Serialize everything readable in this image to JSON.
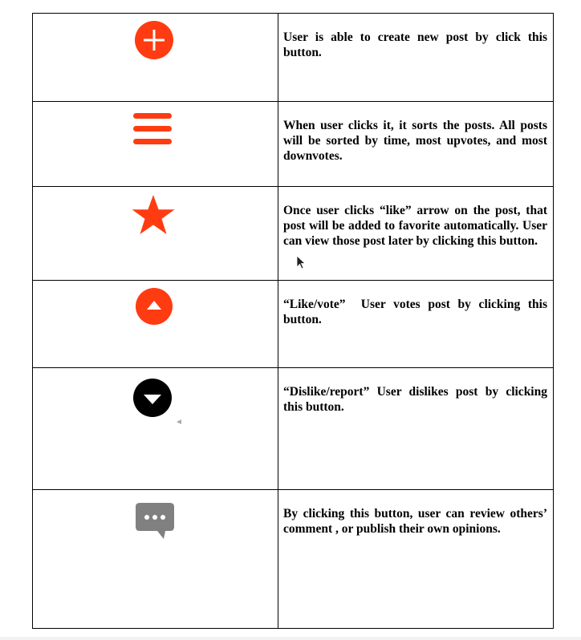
{
  "colors": {
    "accent": "#ff3b12",
    "dislike_icon": "#000000",
    "comment_icon": "#808080",
    "border": "#000000"
  },
  "rows": [
    {
      "icon": "plus-circle-icon",
      "description": "User is able to create new post by click this button."
    },
    {
      "icon": "menu-icon",
      "description": "When user clicks it, it sorts the posts. All posts will be sorted by time, most upvotes, and most downvotes."
    },
    {
      "icon": "star-icon",
      "description": "Once user clicks “like” arrow on the post, that post will be added to favorite automatically. User can view those post later by clicking this button."
    },
    {
      "icon": "upvote-icon",
      "description": "“Like/vote”  User votes post by clicking this button."
    },
    {
      "icon": "downvote-icon",
      "description": "“Dislike/report” User dislikes post by clicking this button."
    },
    {
      "icon": "comment-icon",
      "description": "By clicking this button, user can review others’ comment , or publish their own opinions."
    }
  ]
}
